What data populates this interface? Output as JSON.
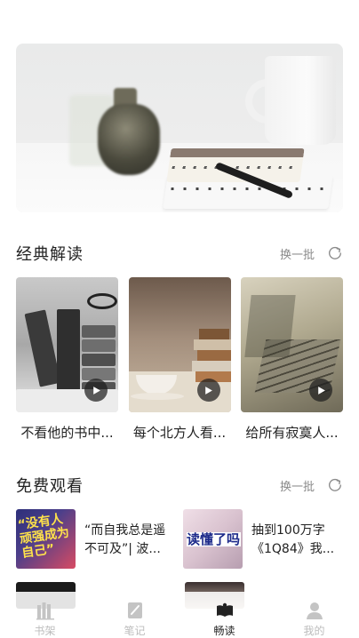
{
  "sections": {
    "classic": {
      "title": "经典解读",
      "refresh_label": "换一批",
      "items": [
        {
          "title": "不看他的书中..."
        },
        {
          "title": "每个北方人看..."
        },
        {
          "title": "给所有寂寞人..."
        }
      ]
    },
    "free": {
      "title": "免费观看",
      "refresh_label": "换一批",
      "items": [
        {
          "title": "“而自我总是遥不可及”| 波...",
          "cover_text": "“没有人顽强成为自己”"
        },
        {
          "title": "抽到100万字《1Q84》我...",
          "cover_text": "读懂了吗"
        }
      ]
    }
  },
  "nav": {
    "items": [
      {
        "label": "书架",
        "icon": "bookshelf-icon"
      },
      {
        "label": "笔记",
        "icon": "notes-icon"
      },
      {
        "label": "畅读",
        "icon": "open-book-icon",
        "active": true
      },
      {
        "label": "我的",
        "icon": "profile-icon"
      }
    ]
  },
  "colors": {
    "accent": "#222222",
    "inactive": "#bcbcbc",
    "muted_text": "#8a8a8a"
  }
}
